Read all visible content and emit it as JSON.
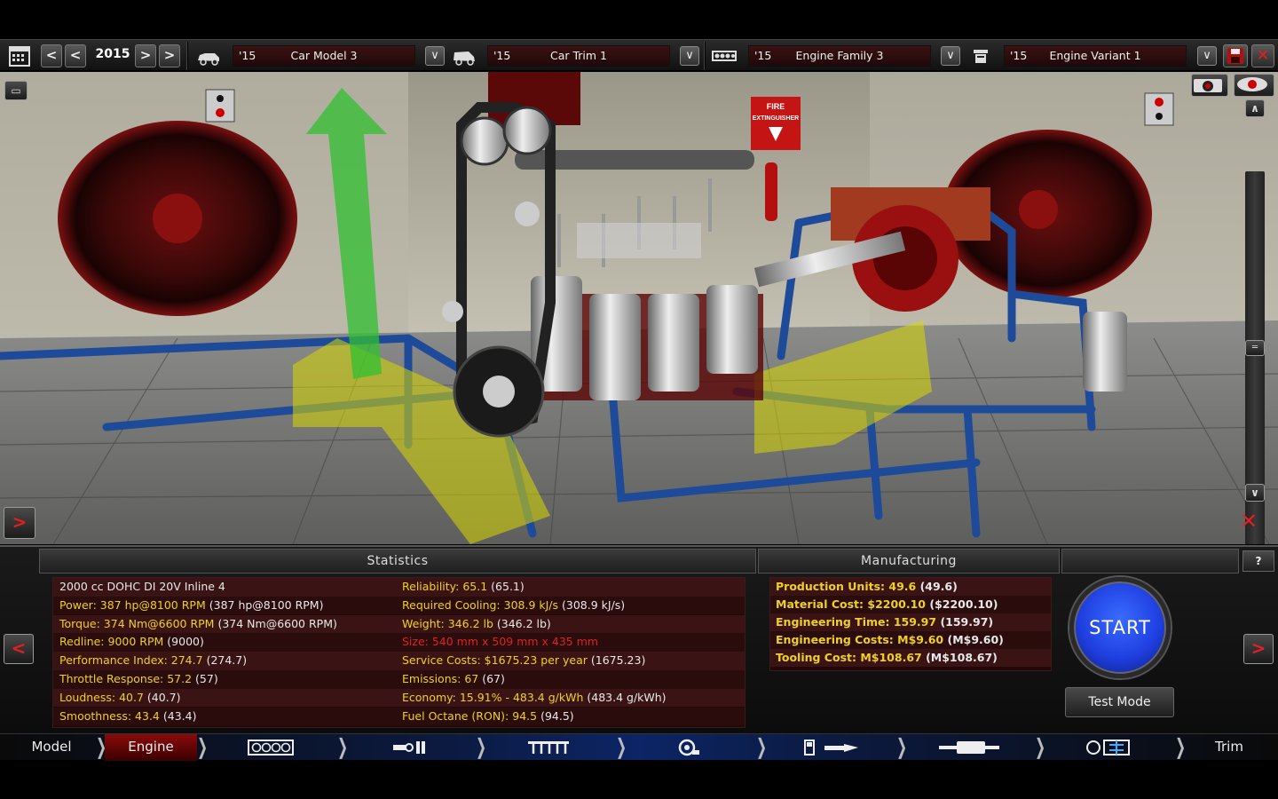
{
  "toolbar": {
    "year": "2015",
    "car_model": {
      "year": "'15",
      "name": "Car Model 3"
    },
    "car_trim": {
      "year": "'15",
      "name": "Car Trim 1"
    },
    "engine_family": {
      "year": "'15",
      "name": "Engine Family 3"
    },
    "engine_variant": {
      "year": "'15",
      "name": "Engine Variant 1"
    },
    "icons": [
      "calendar-icon",
      "car-model-icon",
      "car-trim-icon",
      "engine-family-icon",
      "engine-variant-icon",
      "save-icon",
      "close-icon"
    ]
  },
  "viewport": {
    "sign_fire": "FIRE EXTINGUISHER"
  },
  "statistics": {
    "title": "Statistics",
    "left": [
      {
        "label": "2000 cc DOHC DI 20V Inline 4",
        "value": "",
        "color": "white"
      },
      {
        "label": "Power: 387 hp@8100 RPM",
        "value": "(387 hp@8100 RPM)",
        "color": "yellow"
      },
      {
        "label": "Torque: 374 Nm@6600 RPM",
        "value": "(374 Nm@6600 RPM)",
        "color": "yellow"
      },
      {
        "label": "Redline: 9000 RPM",
        "value": "(9000)",
        "color": "yellow"
      },
      {
        "label": "Performance Index: 274.7",
        "value": "(274.7)",
        "color": "yellow"
      },
      {
        "label": "Throttle Response: 57.2",
        "value": "(57)",
        "color": "yellow"
      },
      {
        "label": "Loudness: 40.7",
        "value": "(40.7)",
        "color": "yellow"
      },
      {
        "label": "Smoothness: 43.4",
        "value": "(43.4)",
        "color": "yellow"
      }
    ],
    "right": [
      {
        "label": "Reliability: 65.1",
        "value": "(65.1)",
        "color": "yellow"
      },
      {
        "label": "Required Cooling: 308.9 kJ/s",
        "value": "(308.9 kJ/s)",
        "color": "yellow"
      },
      {
        "label": "Weight: 346.2 lb",
        "value": "(346.2 lb)",
        "color": "yellow"
      },
      {
        "label": "Size: 540 mm x 509 mm x 435 mm",
        "value": "",
        "color": "red"
      },
      {
        "label": "Service Costs: $1675.23 per year",
        "value": "(1675.23)",
        "color": "yellow"
      },
      {
        "label": "Emissions: 67",
        "value": "(67)",
        "color": "yellow"
      },
      {
        "label": "Economy: 15.91% - 483.4 g/kWh",
        "value": "(483.4 g/kWh)",
        "color": "yellow"
      },
      {
        "label": "Fuel Octane (RON): 94.5",
        "value": "(94.5)",
        "color": "yellow"
      }
    ]
  },
  "manufacturing": {
    "title": "Manufacturing",
    "rows": [
      {
        "label": "Production Units: 49.6",
        "value": "(49.6)"
      },
      {
        "label": "Material Cost: $2200.10",
        "value": "($2200.10)"
      },
      {
        "label": "Engineering Time: 159.97",
        "value": "(159.97)"
      },
      {
        "label": "Engineering Costs: M$9.60",
        "value": "(M$9.60)"
      },
      {
        "label": "Tooling Cost: M$108.67",
        "value": "(M$108.67)"
      }
    ]
  },
  "actions": {
    "start": "START",
    "test_mode": "Test Mode",
    "help": "?"
  },
  "nav": {
    "model": "Model",
    "engine": "Engine",
    "trim": "Trim",
    "icons": [
      "block-icon",
      "crank-icon",
      "head-icon",
      "turbo-icon",
      "fuel-icon",
      "exhaust-icon",
      "dyno-icon"
    ]
  },
  "colors": {
    "accent_yellow": "#f0d020",
    "warning_red": "#e02020",
    "start_blue": "#1f3fe0"
  }
}
